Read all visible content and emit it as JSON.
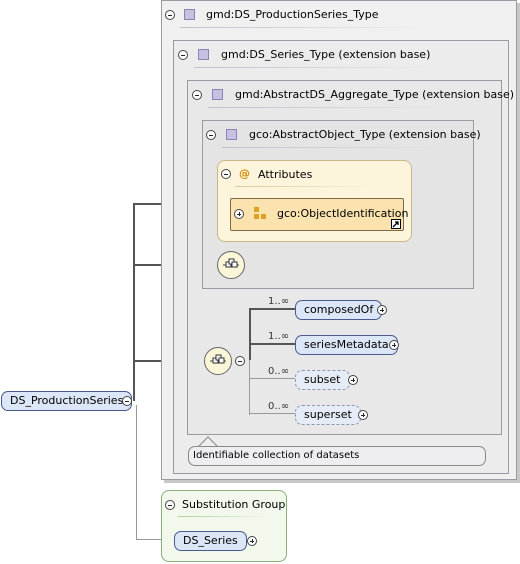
{
  "types": {
    "production_series": "gmd:DS_ProductionSeries_Type",
    "series": "gmd:DS_Series_Type (extension base)",
    "aggregate": "gmd:AbstractDS_Aggregate_Type (extension base)",
    "object": "gco:AbstractObject_Type (extension base)"
  },
  "attributes": {
    "title": "Attributes",
    "at_symbol": "@",
    "attribute_group": "gco:ObjectIdentification"
  },
  "sequence": [
    {
      "name": "composedOf",
      "cardinality": "1..∞"
    },
    {
      "name": "seriesMetadata",
      "cardinality": "1..∞"
    },
    {
      "name": "subset",
      "cardinality": "0..∞"
    },
    {
      "name": "superset",
      "cardinality": "0..∞"
    }
  ],
  "root_element": "DS_ProductionSeries",
  "annotation": "Identifiable collection of datasets",
  "substitution": {
    "title": "Substitution Group",
    "member": "DS_Series"
  },
  "colors": {
    "element_fill": "#dbe6f6",
    "element_border": "#4a5a8c",
    "attributes_fill": "#fdf4dc",
    "attributes_border": "#c8b88a",
    "substitution_fill": "#f2f8ec",
    "substitution_border": "#8cae7c",
    "type_box_fill": "#f0f0f0",
    "type_box_border": "#9a9aa2"
  },
  "icons": [
    "collapse-icon",
    "expand-icon",
    "complex-type-icon",
    "attribute-group-icon",
    "sequence-compositor-icon",
    "shortcut-arrow-icon"
  ]
}
